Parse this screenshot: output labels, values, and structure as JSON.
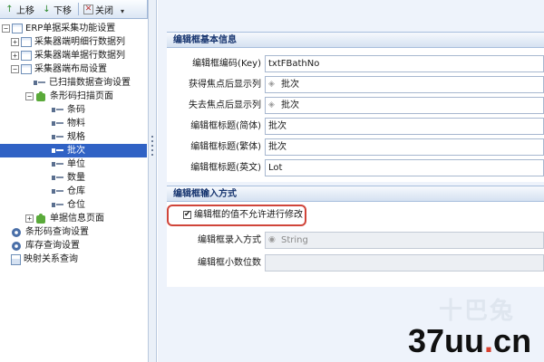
{
  "toolbar": {
    "up_label": "上移",
    "down_label": "下移",
    "close_label": "关闭"
  },
  "tree": {
    "root": "ERP单据采集功能设置",
    "items": [
      "采集器端明细行数据列",
      "采集器端单据行数据列",
      "采集器端布局设置",
      "已扫描数据查询设置",
      "条形码扫描页面",
      "条码",
      "物料",
      "规格",
      "批次",
      "单位",
      "数量",
      "仓库",
      "仓位",
      "单据信息页面",
      "条形码查询设置",
      "库存查询设置",
      "映射关系查询"
    ]
  },
  "basic_group": {
    "title": "编辑框基本信息",
    "code_label": "编辑框编码(Key)",
    "code_value": "txtFBathNo",
    "focus_gain_label": "获得焦点后显示列",
    "focus_gain_value": "批次",
    "focus_lost_label": "失去焦点后显示列",
    "focus_lost_value": "批次",
    "title_simplified_label": "编辑框标题(简体)",
    "title_simplified_value": "批次",
    "title_traditional_label": "编辑框标题(繁体)",
    "title_traditional_value": "批次",
    "title_english_label": "编辑框标题(英文)",
    "title_english_value": "Lot"
  },
  "input_group": {
    "title": "编辑框输入方式",
    "readonly_label": "编辑框的值不允许进行修改",
    "readonly_checked": "✔",
    "input_mode_label": "编辑框录入方式",
    "input_mode_value": "String",
    "decimals_label": "编辑框小数位数",
    "decimals_value": ""
  },
  "watermark": {
    "logo_text": "十巴兔",
    "site_text": "37uu",
    "site_dot": ".",
    "site_tld": "cn"
  },
  "colors": {
    "selected_bg": "#3062c5",
    "accent_red": "#d0453a",
    "header_text": "#15336e"
  }
}
